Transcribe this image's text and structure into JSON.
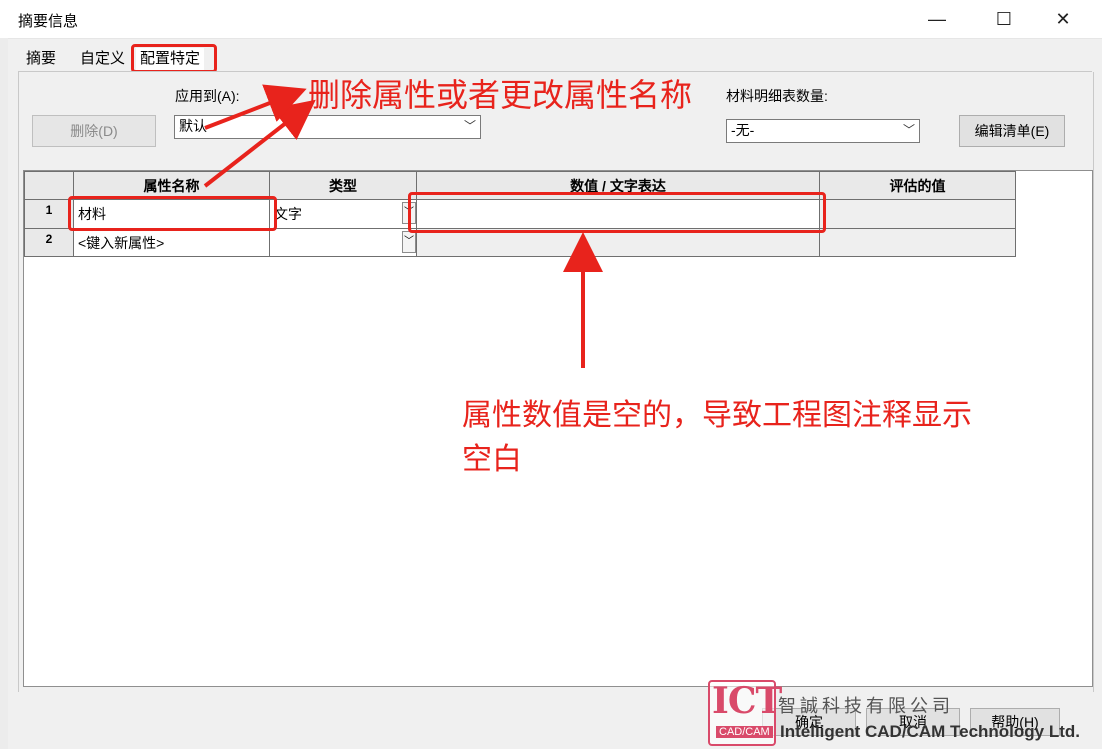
{
  "window": {
    "title": "摘要信息",
    "minimize_glyph": "—",
    "maximize_glyph": "☐",
    "close_glyph": "✕"
  },
  "tabs": [
    {
      "label": "摘要",
      "selected": false
    },
    {
      "label": "自定义",
      "selected": false
    },
    {
      "label": "配置特定",
      "selected": true
    }
  ],
  "toolbar": {
    "delete_label": "删除(D)",
    "apply_to_label": "应用到(A):",
    "apply_to_value": "默认",
    "bom_qty_label": "材料明细表数量:",
    "bom_qty_value": "-无-",
    "edit_list_label": "编辑清单(E)"
  },
  "grid": {
    "columns": [
      "属性名称",
      "类型",
      "数值 / 文字表达",
      "评估的值"
    ],
    "rows": [
      {
        "num": "1",
        "name": "材料",
        "type": "文字",
        "value": "",
        "evaluated": ""
      },
      {
        "num": "2",
        "name": "<键入新属性>",
        "type": "",
        "value": "",
        "evaluated": ""
      }
    ]
  },
  "annotations": {
    "top_note": "删除属性或者更改属性名称",
    "bottom_note_line1": "属性数值是空的，导致工程图注释显示",
    "bottom_note_line2": "空白",
    "color": "#e8231c"
  },
  "footer": {
    "ok_label": "确定",
    "cancel_label": "取消",
    "help_label": "帮助(H)"
  },
  "watermark": {
    "logo_letters": "ICT",
    "logo_sub": "CAD/CAM",
    "company_cn": "智誠科技有限公司",
    "company_en": "Intelligent CAD/CAM Technology Ltd."
  }
}
